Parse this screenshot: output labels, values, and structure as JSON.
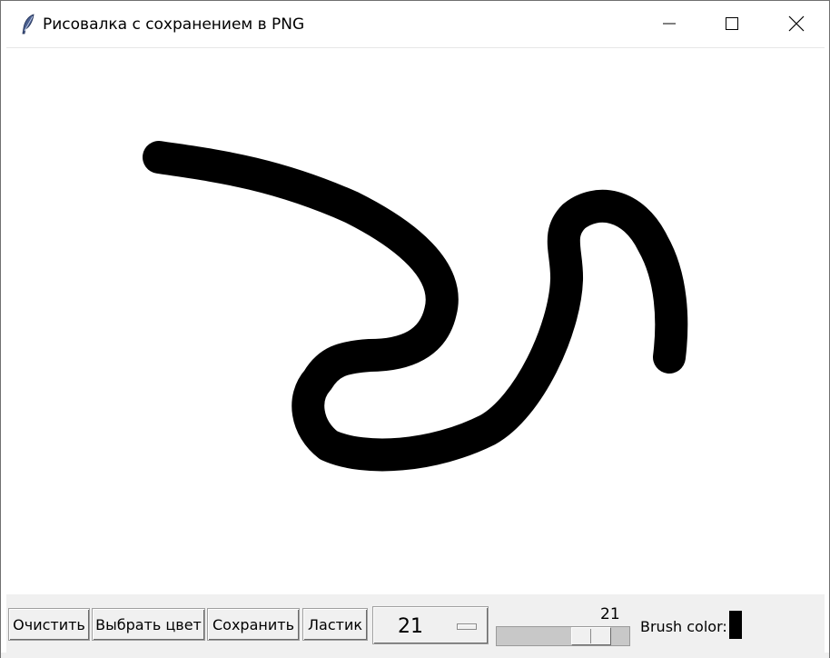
{
  "window": {
    "title": "Рисовалка с сохранением в PNG"
  },
  "icons": {
    "app": "feather-icon",
    "minimize": "minimize-icon",
    "maximize": "maximize-icon",
    "close": "close-icon"
  },
  "toolbar": {
    "clear_label": "Очистить",
    "choose_color_label": "Выбрать цвет",
    "save_label": "Сохранить",
    "eraser_label": "Ластик",
    "size_option": "21",
    "size_scale_value": "21",
    "size_scale_fraction": 0.2,
    "brush_color_label": "Brush color:"
  },
  "colors": {
    "brush": "#000000",
    "canvas": "#ffffff",
    "toolbar_bg": "#f0f0f0"
  }
}
